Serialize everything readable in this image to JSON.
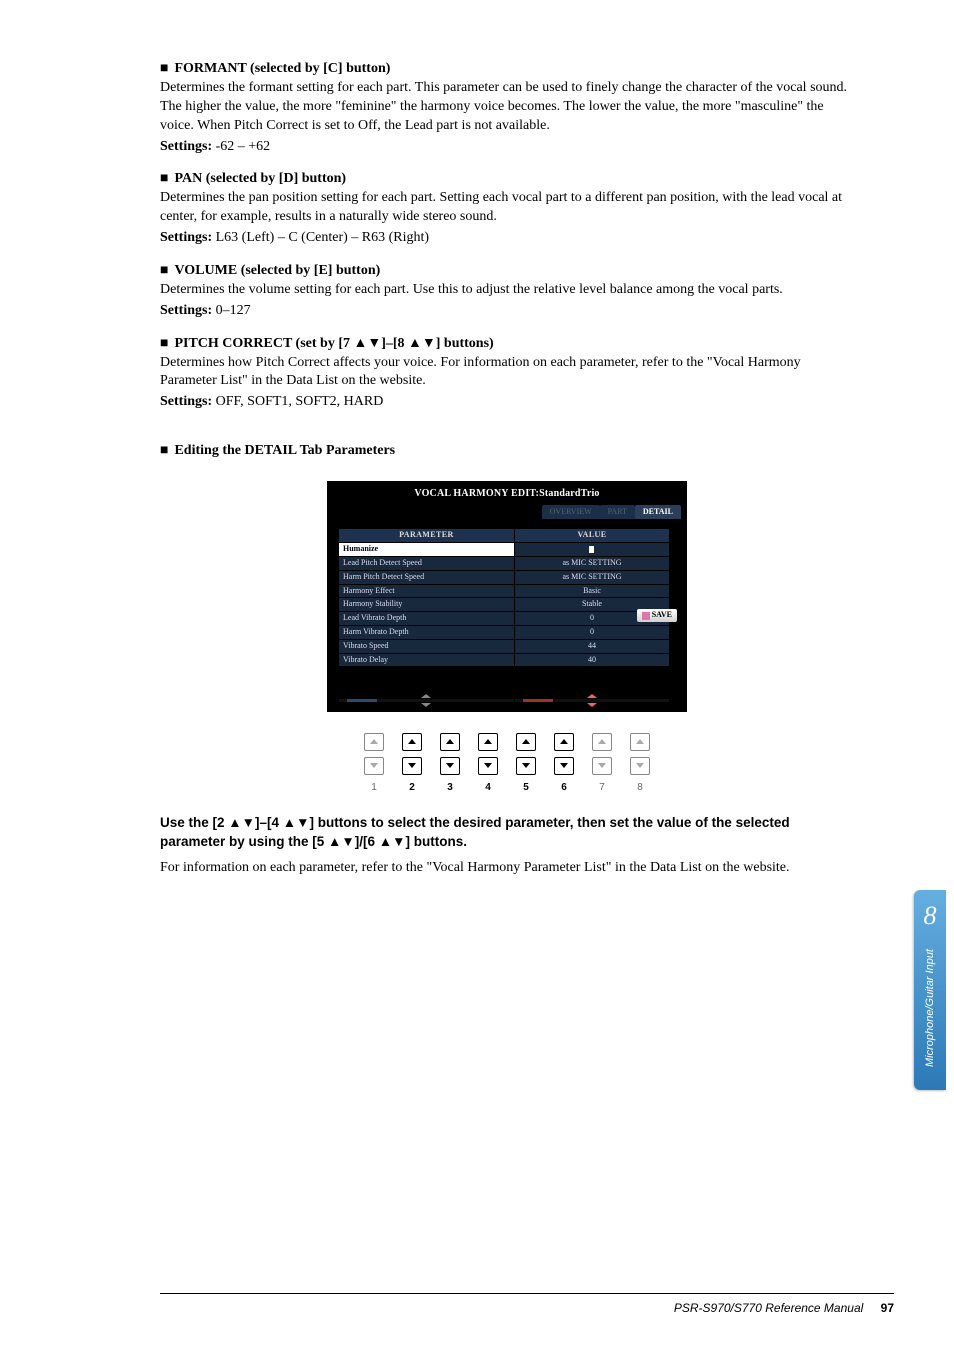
{
  "formant": {
    "heading": "FORMANT (selected by [C] button)",
    "body": "Determines the formant setting for each part. This parameter can be used to finely change the character of the vocal sound. The higher the value, the more \"feminine\" the harmony voice becomes. The lower the value, the more \"masculine\" the voice. When Pitch Correct is set to Off, the Lead part is not available.",
    "settings_label": "Settings:",
    "settings_value": " -62 – +62"
  },
  "pan": {
    "heading": "PAN (selected by [D] button)",
    "body": "Determines the pan position setting for each part. Setting each vocal part to a different pan position, with the lead vocal at center, for example, results in a naturally wide stereo sound.",
    "settings_label": "Settings:",
    "settings_value": " L63 (Left) – C (Center) – R63 (Right)"
  },
  "volume": {
    "heading": "VOLUME (selected by [E] button)",
    "body": "Determines the volume setting for each part. Use this to adjust the relative level balance among the vocal parts.",
    "settings_label": "Settings:",
    "settings_value": " 0–127"
  },
  "pitch": {
    "heading": "PITCH CORRECT (set by [7 ▲▼]–[8 ▲▼] buttons)",
    "body": "Determines how Pitch Correct affects your voice. For information on each parameter, refer to the \"Vocal Harmony Parameter List\" in the Data List on the website.",
    "settings_label": "Settings:",
    "settings_value": " OFF, SOFT1, SOFT2, HARD"
  },
  "detail_heading": "Editing the DETAIL Tab Parameters",
  "screenshot": {
    "title": "VOCAL HARMONY EDIT:StandardTrio",
    "tabs": {
      "overview": "OVERVIEW",
      "part": "PART",
      "detail": "DETAIL"
    },
    "col_param": "PARAMETER",
    "col_value": "VALUE",
    "rows": [
      {
        "param": "Humanize",
        "value": "",
        "selected": true
      },
      {
        "param": "Lead Pitch Detect Speed",
        "value": "as MIC SETTING"
      },
      {
        "param": "Harm Pitch Detect Speed",
        "value": "as MIC SETTING"
      },
      {
        "param": "Harmony Effect",
        "value": "Basic"
      },
      {
        "param": "Harmony Stability",
        "value": "Stable"
      },
      {
        "param": "Lead Vibrato Depth",
        "value": "0"
      },
      {
        "param": "Harm Vibrato Depth",
        "value": "0"
      },
      {
        "param": "Vibrato Speed",
        "value": "44"
      },
      {
        "param": "Vibrato Delay",
        "value": "40"
      }
    ],
    "save": "SAVE"
  },
  "strip_numbers": [
    "1",
    "2",
    "3",
    "4",
    "5",
    "6",
    "7",
    "8"
  ],
  "instruction": {
    "line": "Use the [2 ▲▼]–[4 ▲▼] buttons to select the desired parameter, then set the value of the selected parameter by using the [5 ▲▼]/[6 ▲▼] buttons.",
    "body": "For information on each parameter, refer to the \"Vocal Harmony Parameter List\" in the Data List on the website."
  },
  "sidetab": {
    "num": "8",
    "label": "Microphone/Guitar Input"
  },
  "footer": {
    "manual": "PSR-S970/S770 Reference Manual",
    "page": "97"
  }
}
